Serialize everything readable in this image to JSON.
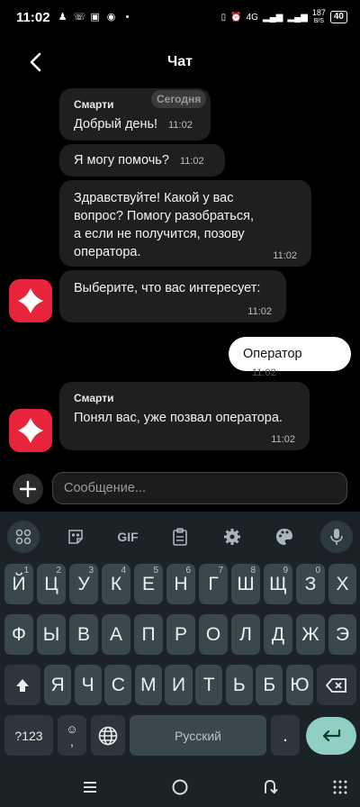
{
  "status_bar": {
    "time": "11:02",
    "network": "4G",
    "speed_value": "187",
    "speed_unit": "B/S",
    "battery": "40"
  },
  "header": {
    "title": "Чат"
  },
  "chat": {
    "date_chip": "Сегодня",
    "messages": [
      {
        "sender": "Смарти",
        "text": "Добрый день!",
        "time": "11:02"
      },
      {
        "text": "Я могу помочь?",
        "time": "11:02"
      },
      {
        "text": "Здравствуйте! Какой у вас вопрос? Помогу разобраться, а если не получится, позову оператора.",
        "lines": [
          "Здравствуйте! Какой у вас",
          "вопрос? Помогу разобраться,",
          "а если не получится, позову",
          "оператора."
        ],
        "time": "11:02"
      },
      {
        "text": "Выберите, что вас интересует:",
        "time": "11:02"
      },
      {
        "text": "Оператор",
        "time": "11:02",
        "from_user": true
      },
      {
        "sender": "Смарти",
        "text": "Понял вас, уже позвал оператора.",
        "time": "11:02"
      }
    ]
  },
  "input": {
    "placeholder": "Сообщение..."
  },
  "keyboard": {
    "toolbar": {
      "gif_label": "GIF"
    },
    "row1": [
      {
        "label": "Й",
        "hint": "1"
      },
      {
        "label": "Ц",
        "hint": "2"
      },
      {
        "label": "У",
        "hint": "3"
      },
      {
        "label": "К",
        "hint": "4"
      },
      {
        "label": "Е",
        "hint": "5"
      },
      {
        "label": "Н",
        "hint": "6"
      },
      {
        "label": "Г",
        "hint": "7"
      },
      {
        "label": "Ш",
        "hint": "8"
      },
      {
        "label": "Щ",
        "hint": "9"
      },
      {
        "label": "З",
        "hint": "0"
      },
      {
        "label": "Х",
        "hint": ""
      }
    ],
    "row2": [
      "Ф",
      "Ы",
      "В",
      "А",
      "П",
      "Р",
      "О",
      "Л",
      "Д",
      "Ж",
      "Э"
    ],
    "row3": [
      "Я",
      "Ч",
      "С",
      "М",
      "И",
      "Т",
      "Ь",
      "Б",
      "Ю"
    ],
    "symbols_label": "?123",
    "comma_label": ",",
    "space_label": "Русский",
    "period_label": "."
  },
  "colors": {
    "bot_avatar": "#e8243a",
    "bubble": "#1f1f1f",
    "enter_key": "#8fd0c3",
    "keyboard_bg": "#1b2327"
  }
}
